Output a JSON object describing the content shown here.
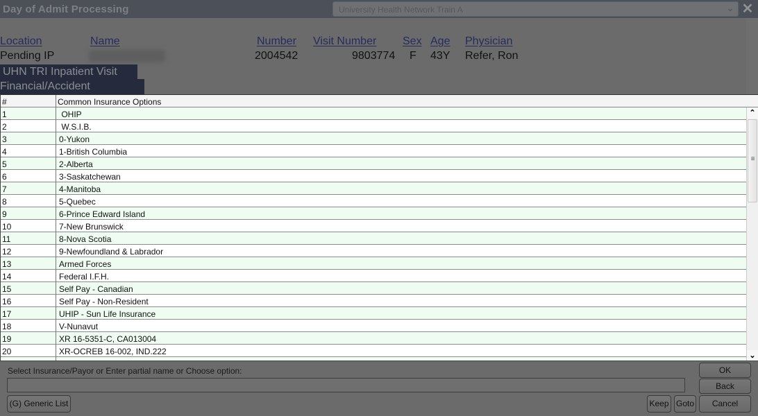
{
  "window": {
    "title": "Day of Admit Processing",
    "environment": "University Health Network Train A",
    "close_icon": "close-icon",
    "dropdown_icon": "chevron-down-icon"
  },
  "patient_header": {
    "labels": {
      "location": "Location",
      "name": "Name",
      "number": "Number",
      "visit_number": "Visit Number",
      "sex": "Sex",
      "age": "Age",
      "physician": "Physician"
    },
    "values": {
      "location": "Pending IP",
      "name": "",
      "number": "2004542",
      "visit_number": "9803774",
      "sex": "F",
      "age": "43Y",
      "physician": "Refer, Ron"
    }
  },
  "banners": {
    "visit_type": "UHN TRI Inpatient Visit (FM)",
    "section": "Financial/Accident Information"
  },
  "table": {
    "columns": [
      "#",
      "Common Insurance Options"
    ],
    "rows": [
      {
        "num": "1",
        "option": " OHIP"
      },
      {
        "num": "2",
        "option": " W.S.I.B."
      },
      {
        "num": "3",
        "option": "0-Yukon"
      },
      {
        "num": "4",
        "option": "1-British Columbia"
      },
      {
        "num": "5",
        "option": "2-Alberta"
      },
      {
        "num": "6",
        "option": "3-Saskatchewan"
      },
      {
        "num": "7",
        "option": "4-Manitoba"
      },
      {
        "num": "8",
        "option": "5-Quebec"
      },
      {
        "num": "9",
        "option": "6-Prince Edward Island"
      },
      {
        "num": "10",
        "option": "7-New Brunswick"
      },
      {
        "num": "11",
        "option": "8-Nova Scotia"
      },
      {
        "num": "12",
        "option": "9-Newfoundland & Labrador"
      },
      {
        "num": "13",
        "option": "Armed Forces"
      },
      {
        "num": "14",
        "option": "Federal I.F.H."
      },
      {
        "num": "15",
        "option": "Self Pay - Canadian"
      },
      {
        "num": "16",
        "option": "Self Pay - Non-Resident"
      },
      {
        "num": "17",
        "option": "UHIP - Sun Life Insurance"
      },
      {
        "num": "18",
        "option": "V-Nunavut"
      },
      {
        "num": "19",
        "option": "XR 16-5351-C, CA013004"
      },
      {
        "num": "20",
        "option": "XR-OCREB 16-002, IND.222"
      },
      {
        "num": "",
        "option": ""
      }
    ],
    "scroll_position_fraction": 0.0
  },
  "bottom": {
    "prompt": "Select Insurance/Payor or Enter partial name or Choose option:",
    "entry_value": "",
    "buttons": {
      "generic_list": "(G) Generic List",
      "ok": "OK",
      "back": "Back",
      "keep": "Keep",
      "goto": "Goto",
      "cancel": "Cancel"
    }
  }
}
